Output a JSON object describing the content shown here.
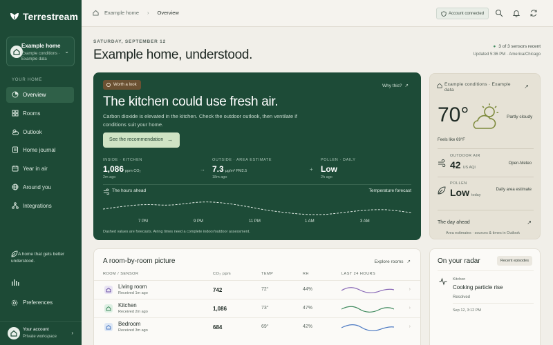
{
  "app": {
    "name": "Terrestream"
  },
  "home_selector": {
    "title": "Example home",
    "subtitle": "Example conditions · Example data"
  },
  "sidebar": {
    "section_label": "YOUR HOME",
    "items": [
      {
        "label": "Overview",
        "icon": "overview-icon"
      },
      {
        "label": "Rooms",
        "icon": "rooms-icon"
      },
      {
        "label": "Outlook",
        "icon": "outlook-icon"
      },
      {
        "label": "Home journal",
        "icon": "journal-icon"
      },
      {
        "label": "Year in air",
        "icon": "calendar-icon"
      },
      {
        "label": "Around you",
        "icon": "globe-icon"
      },
      {
        "label": "Integrations",
        "icon": "integrations-icon"
      }
    ],
    "tagline": "A home that gets better understood.",
    "preferences": "Preferences",
    "account": {
      "title": "Your account",
      "subtitle": "Private workspace"
    }
  },
  "topbar": {
    "breadcrumb": [
      "Example home",
      "Overview"
    ],
    "account_status": "Account connected"
  },
  "header": {
    "date": "SATURDAY, SEPTEMBER 12",
    "title": "Example home, understood.",
    "sensors": "3 of 3 sensors recent",
    "updated": "Updated 5:36 PM · America/Chicago"
  },
  "hero": {
    "badge": "Worth a look",
    "why": "Why this?",
    "title": "The kitchen could use fresh air.",
    "body": "Carbon dioxide is elevated in the kitchen. Check the outdoor outlook, then ventilate if conditions suit your home.",
    "cta": "See the recommendation",
    "metrics": [
      {
        "label": "INSIDE · KITCHEN",
        "value": "1,086",
        "unit": "ppm CO₂",
        "when": "2m ago"
      },
      {
        "label": "OUTSIDE · AREA ESTIMATE",
        "value": "7.3",
        "unit": "µg/m³ PM2.5",
        "when": "18m ago"
      },
      {
        "label": "POLLEN · DAILY",
        "value": "Low",
        "unit": "",
        "when": "2h ago"
      }
    ],
    "hours_label": "The hours ahead",
    "forecast_label": "Temperature forecast",
    "ticks": [
      "7 PM",
      "9 PM",
      "11 PM",
      "1 AM",
      "3 AM"
    ],
    "note": "Dashed values are forecasts. Airing times need a complete indoor/outdoor assessment."
  },
  "weather": {
    "heading": "Example conditions · Example data",
    "temp": "70°",
    "condition": "Partly cloudy",
    "feels": "Feels like 69°F",
    "air": {
      "label": "OUTDOOR AIR",
      "value": "42",
      "unit": "US AQI",
      "source": "Open-Meteo"
    },
    "pollen": {
      "label": "POLLEN",
      "value": "Low",
      "unit": "today",
      "source": "Daily area estimate"
    },
    "day_ahead": "The day ahead",
    "footer": "Area estimates · sources & times in Outlook"
  },
  "rooms": {
    "title": "A room-by-room picture",
    "explore": "Explore rooms",
    "columns": [
      "ROOM / SENSOR",
      "CO₂ ppm",
      "TEMP",
      "RH",
      "LAST 24 HOURS"
    ],
    "rows": [
      {
        "name": "Living room",
        "received": "Received 1m ago",
        "co2": "742",
        "temp": "72°",
        "rh": "44%",
        "spark_color": "#8b6bb8"
      },
      {
        "name": "Kitchen",
        "received": "Received 2m ago",
        "co2": "1,086",
        "temp": "73°",
        "rh": "47%",
        "spark_color": "#3f8a5e"
      },
      {
        "name": "Bedroom",
        "received": "Received 3m ago",
        "co2": "684",
        "temp": "69°",
        "rh": "42%",
        "spark_color": "#4a78c2"
      }
    ]
  },
  "radar": {
    "title": "On your radar",
    "pill": "Recent episodes",
    "room": "Kitchen",
    "episode": "Cooking particle rise",
    "status": "Resolved",
    "date": "Sep 12, 3:12 PM"
  },
  "colors": {
    "sidebar": "#1d4a36",
    "hero": "#1d4b37",
    "accent_cta": "#cfe3c4",
    "badge": "#6b5132"
  }
}
